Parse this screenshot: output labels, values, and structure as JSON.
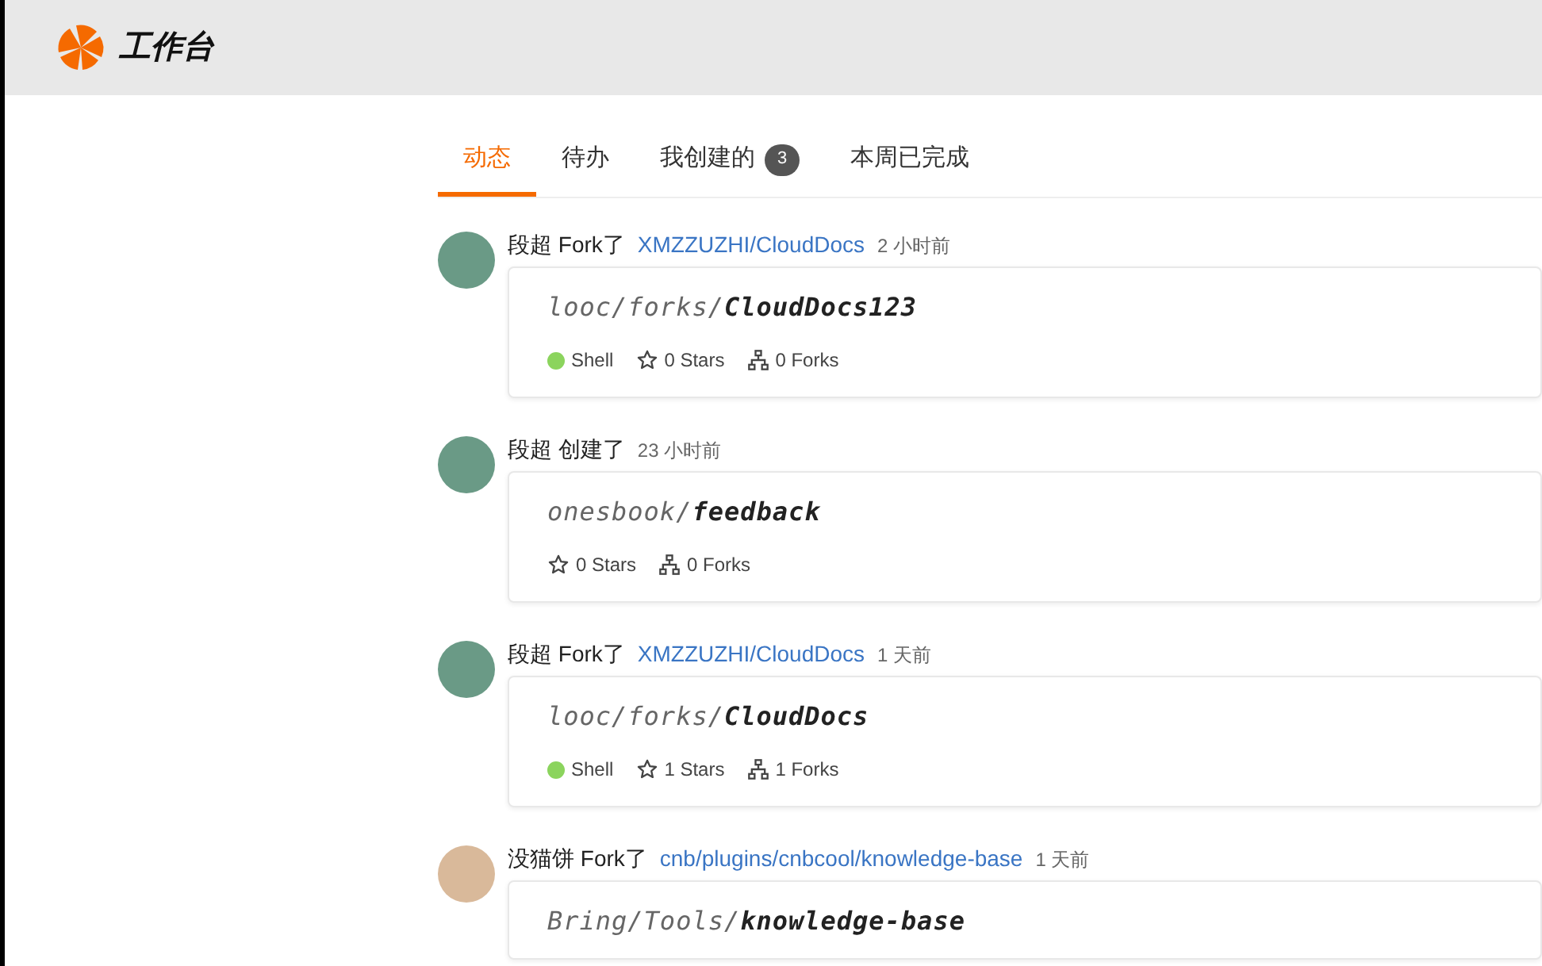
{
  "header": {
    "title": "工作台"
  },
  "tabs": [
    {
      "label": "动态",
      "selected": true
    },
    {
      "label": "待办",
      "selected": false
    },
    {
      "label": "我创建的",
      "badge": "3",
      "selected": false
    },
    {
      "label": "本周已完成",
      "selected": false
    }
  ],
  "events": [
    {
      "user": "段超",
      "action": "Fork了",
      "link": "XMZZUZHI/CloudDocs",
      "time": "2 小时前",
      "repo": {
        "path": "looc/forks/",
        "name": "CloudDocs123",
        "language": {
          "name": "Shell",
          "color": "#8bd45d"
        },
        "stars": "0 Stars",
        "forks": "0 Forks"
      }
    },
    {
      "user": "段超",
      "action": "创建了",
      "time": "23 小时前",
      "repo": {
        "path": "onesbook/",
        "name": "feedback",
        "stars": "0 Stars",
        "forks": "0 Forks"
      }
    },
    {
      "user": "段超",
      "action": "Fork了",
      "link": "XMZZUZHI/CloudDocs",
      "time": "1 天前",
      "repo": {
        "path": "looc/forks/",
        "name": "CloudDocs",
        "language": {
          "name": "Shell",
          "color": "#8bd45d"
        },
        "stars": "1 Stars",
        "forks": "1 Forks"
      }
    },
    {
      "user": "没猫饼",
      "action": "Fork了",
      "link": "cnb/plugins/cnbcool/knowledge-base",
      "time": "1 天前",
      "repo": {
        "path": "Bring/Tools/",
        "name": "knowledge-base"
      }
    }
  ]
}
